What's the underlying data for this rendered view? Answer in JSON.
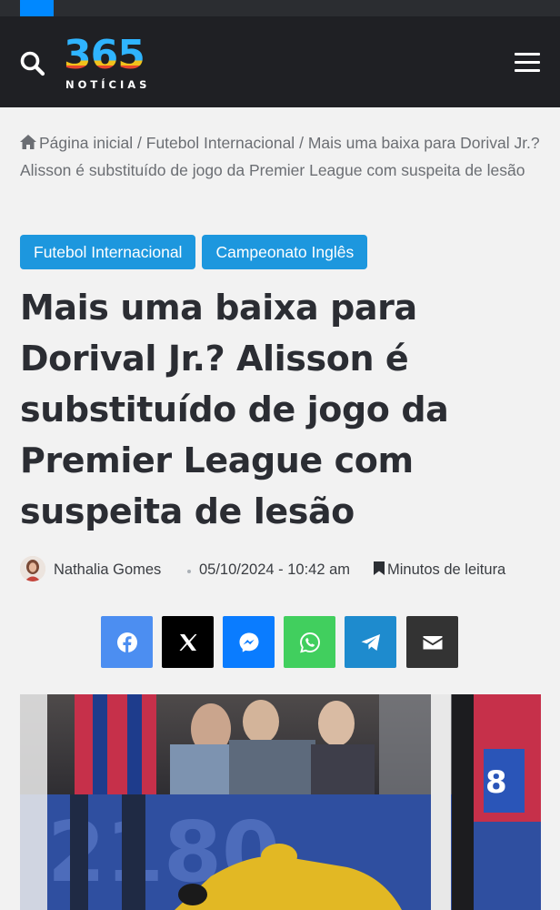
{
  "header": {
    "logo_number": "365",
    "logo_sub": "NOTÍCIAS",
    "icons": {
      "search": "search-icon",
      "menu": "hamburger-menu-icon"
    },
    "colors": {
      "background": "#1f2024",
      "topbar": "#2b2d31",
      "accent": "#0088ff"
    }
  },
  "breadcrumb": {
    "home_icon": "home-icon",
    "home": "Página inicial",
    "separator": "/",
    "section": "Futebol Internacional",
    "current": "Mais uma baixa para Dorival Jr.? Alisson é substituído de jogo da Premier League com suspeita de lesão"
  },
  "categories": [
    {
      "label": "Futebol Internacional"
    },
    {
      "label": "Campeonato Inglês"
    }
  ],
  "category_color": "#1d97de",
  "article": {
    "title": "Mais uma baixa para Dorival Jr.? Alisson é substituído de jogo da Premier League com suspeita de lesão",
    "author": "Nathalia Gomes",
    "date": "05/10/2024 - 10:42 am",
    "reading": "Minutos de leitura",
    "reading_icon": "bookmark-icon"
  },
  "share": [
    {
      "network": "Facebook",
      "icon": "facebook-icon",
      "color": "#4c8ef1"
    },
    {
      "network": "X",
      "icon": "x-icon",
      "color": "#000000"
    },
    {
      "network": "Messenger",
      "icon": "messenger-icon",
      "color": "#0a7cff"
    },
    {
      "network": "WhatsApp",
      "icon": "whatsapp-icon",
      "color": "#41cf5e"
    },
    {
      "network": "Telegram",
      "icon": "telegram-icon",
      "color": "#1e8bce"
    },
    {
      "network": "Email",
      "icon": "envelope-icon",
      "color": "#333333"
    }
  ],
  "image": {
    "description_icon": "featured-photo"
  }
}
